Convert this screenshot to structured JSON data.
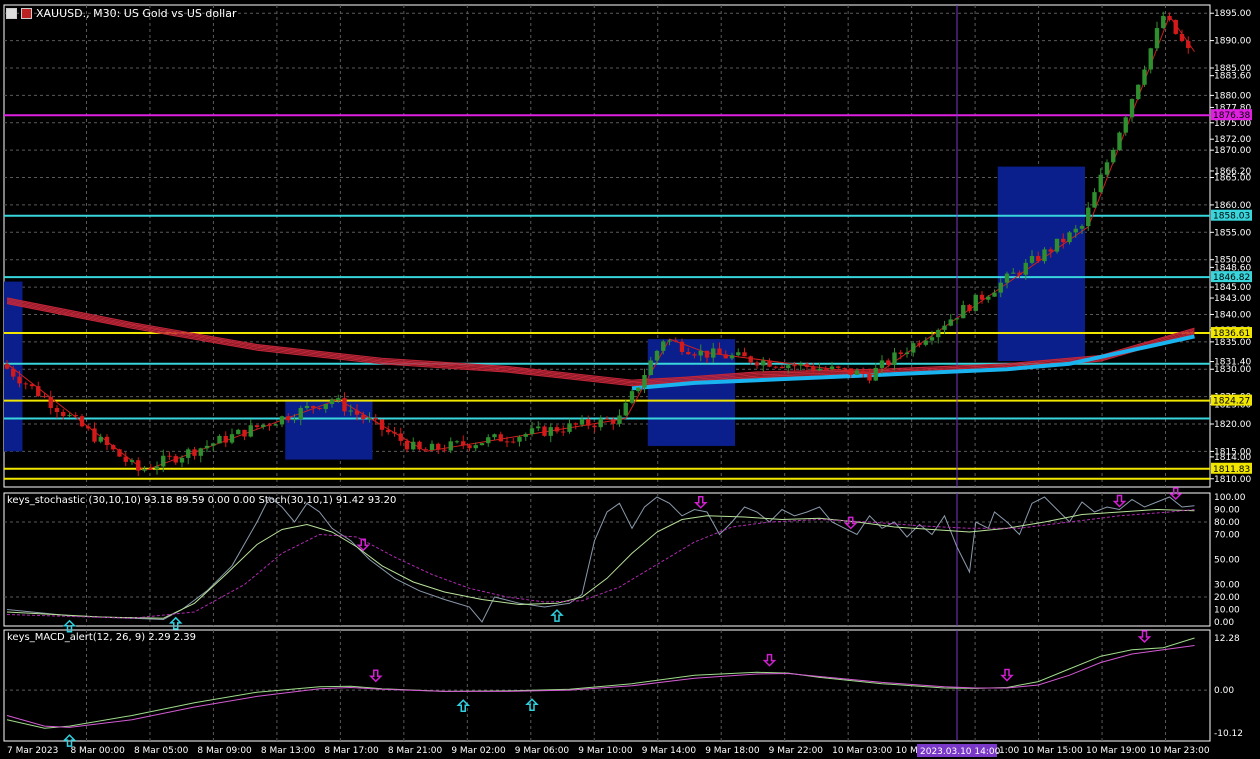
{
  "header": {
    "title": "XAUUSD., M30:  US Gold vs US dollar"
  },
  "colors": {
    "background": "#000000",
    "grid": "#5a5a5a",
    "bull": "#2f8f2f",
    "bear": "#d21a1a",
    "ma_red": "#c02638",
    "ma_blue": "#19b4f0",
    "level_yellow": "#f0e600",
    "level_cyan": "#38d6dc",
    "level_magenta": "#e020e0",
    "zone_blue": "#0a1e8c",
    "zigzag": "#d02020",
    "stoch_main": "#8a9aac",
    "stoch_signal": "#b8e29a",
    "stoch_dash": "#b02ab0",
    "macd_main": "#9fdc8a",
    "macd_signal": "#d45ad4",
    "arrow_up": "#30d0e0",
    "arrow_down": "#d020d0",
    "vline": "#7a38c8"
  },
  "chart_data": [
    {
      "type": "candlestick",
      "title": "XAUUSD., M30:  US Gold vs US dollar",
      "ylim": [
        1808.5,
        1896.5
      ],
      "price_ticks": [
        "1895.00",
        "1890.00",
        "1885.00",
        "1883.60",
        "1880.00",
        "1877.80",
        "1875.00",
        "1872.00",
        "1870.00",
        "1866.20",
        "1865.00",
        "1860.00",
        "1855.00",
        "1850.00",
        "1848.60",
        "1845.00",
        "1843.00",
        "1840.00",
        "1837.20",
        "1835.00",
        "1831.40",
        "1830.00",
        "1825.00",
        "1823.60",
        "1820.00",
        "1815.00",
        "1814.00",
        "1810.00"
      ],
      "x_labels": [
        "7 Mar 2023",
        "8 Mar 00:00",
        "8 Mar 05:00",
        "8 Mar 09:00",
        "8 Mar 13:00",
        "8 Mar 17:00",
        "8 Mar 21:00",
        "9 Mar 02:00",
        "9 Mar 06:00",
        "9 Mar 10:00",
        "9 Mar 14:00",
        "9 Mar 18:00",
        "9 Mar 22:00",
        "10 Mar 03:00",
        "10 Mar 07:00",
        "10 Mar 11:00",
        "10 Mar 15:00",
        "10 Mar 19:00",
        "10 Mar 23:00"
      ],
      "cursor_time_label": "2023.03.10 14:00",
      "level_labels": [
        {
          "value": 1876.38,
          "text": "1876.38",
          "kind": "magenta"
        },
        {
          "value": 1858.03,
          "text": "1858.03",
          "kind": "cyan"
        },
        {
          "value": 1846.82,
          "text": "1846.82",
          "kind": "cyan"
        },
        {
          "value": 1836.61,
          "text": "1836.61",
          "kind": "yellow"
        },
        {
          "value": 1831.0,
          "text": "",
          "kind": "cyan"
        },
        {
          "value": 1824.27,
          "text": "1824.27",
          "kind": "yellow"
        },
        {
          "value": 1821.0,
          "text": "",
          "kind": "cyan"
        },
        {
          "value": 1811.83,
          "text": "1811.83",
          "kind": "yellow"
        },
        {
          "value": 1810.0,
          "text": "",
          "kind": "yellow"
        }
      ],
      "zones": [
        {
          "from": 0,
          "to": 2,
          "high": 1846.0,
          "low": 1815.0
        },
        {
          "from": 45,
          "to": 58,
          "high": 1824.5,
          "low": 1813.5
        },
        {
          "from": 103,
          "to": 116,
          "high": 1835.5,
          "low": 1816.0
        },
        {
          "from": 159,
          "to": 172,
          "high": 1867.0,
          "low": 1831.5
        }
      ],
      "zigzag": [
        [
          0,
          1831
        ],
        [
          22,
          1811.5
        ],
        [
          53,
          1824.5
        ],
        [
          67,
          1815
        ],
        [
          99,
          1821
        ],
        [
          106,
          1835.5
        ],
        [
          112,
          1833
        ],
        [
          139,
          1829
        ],
        [
          173,
          1856
        ],
        [
          186,
          1894.5
        ],
        [
          190,
          1888
        ]
      ],
      "ma_red": [
        [
          0,
          1842.5
        ],
        [
          20,
          1838
        ],
        [
          40,
          1834
        ],
        [
          60,
          1831.5
        ],
        [
          80,
          1830
        ],
        [
          100,
          1827.5
        ],
        [
          108,
          1828
        ],
        [
          120,
          1829
        ],
        [
          140,
          1829.5
        ],
        [
          160,
          1830.5
        ],
        [
          175,
          1832
        ],
        [
          190,
          1837
        ]
      ],
      "ma_blue": [
        [
          100,
          1826.5
        ],
        [
          110,
          1827.5
        ],
        [
          120,
          1828
        ],
        [
          140,
          1829
        ],
        [
          160,
          1830
        ],
        [
          170,
          1831
        ],
        [
          180,
          1833.5
        ],
        [
          190,
          1836
        ]
      ]
    },
    {
      "type": "line",
      "name": "keys_stochastic",
      "label": "keys_stochastic (30,10,10) 93.18 89.59 0.00 0.00 Stoch(30,10,1) 91.42 93.20",
      "ylim": [
        0,
        100
      ],
      "y_ticks": [
        "100.00",
        "90.00",
        "80.00",
        "70.00",
        "50.00",
        "30.00",
        "20.00",
        "10.00",
        "0.00"
      ],
      "main": [
        [
          0,
          10
        ],
        [
          10,
          5
        ],
        [
          20,
          3
        ],
        [
          25,
          2
        ],
        [
          28,
          10
        ],
        [
          32,
          25
        ],
        [
          36,
          45
        ],
        [
          40,
          80
        ],
        [
          42,
          100
        ],
        [
          44,
          92
        ],
        [
          46,
          80
        ],
        [
          48,
          95
        ],
        [
          50,
          88
        ],
        [
          52,
          75
        ],
        [
          55,
          65
        ],
        [
          58,
          50
        ],
        [
          62,
          35
        ],
        [
          66,
          25
        ],
        [
          70,
          18
        ],
        [
          74,
          12
        ],
        [
          76,
          0
        ],
        [
          78,
          20
        ],
        [
          82,
          15
        ],
        [
          86,
          12
        ],
        [
          90,
          15
        ],
        [
          92,
          22
        ],
        [
          94,
          65
        ],
        [
          96,
          88
        ],
        [
          98,
          95
        ],
        [
          100,
          75
        ],
        [
          102,
          92
        ],
        [
          104,
          100
        ],
        [
          106,
          95
        ],
        [
          108,
          85
        ],
        [
          110,
          90
        ],
        [
          112,
          88
        ],
        [
          114,
          70
        ],
        [
          116,
          80
        ],
        [
          118,
          92
        ],
        [
          120,
          88
        ],
        [
          122,
          80
        ],
        [
          124,
          90
        ],
        [
          126,
          85
        ],
        [
          128,
          88
        ],
        [
          130,
          92
        ],
        [
          132,
          80
        ],
        [
          136,
          70
        ],
        [
          138,
          85
        ],
        [
          140,
          75
        ],
        [
          142,
          80
        ],
        [
          144,
          68
        ],
        [
          146,
          78
        ],
        [
          148,
          70
        ],
        [
          150,
          85
        ],
        [
          152,
          60
        ],
        [
          154,
          40
        ],
        [
          155,
          80
        ],
        [
          157,
          75
        ],
        [
          158,
          88
        ],
        [
          160,
          80
        ],
        [
          162,
          70
        ],
        [
          164,
          95
        ],
        [
          166,
          100
        ],
        [
          168,
          90
        ],
        [
          170,
          80
        ],
        [
          172,
          96
        ],
        [
          174,
          88
        ],
        [
          176,
          92
        ],
        [
          178,
          90
        ],
        [
          180,
          98
        ],
        [
          182,
          92
        ],
        [
          184,
          96
        ],
        [
          186,
          100
        ],
        [
          188,
          92
        ],
        [
          190,
          93
        ]
      ],
      "signal": [
        [
          0,
          8
        ],
        [
          15,
          4
        ],
        [
          25,
          3
        ],
        [
          30,
          15
        ],
        [
          35,
          38
        ],
        [
          40,
          62
        ],
        [
          44,
          74
        ],
        [
          48,
          78
        ],
        [
          52,
          72
        ],
        [
          56,
          60
        ],
        [
          60,
          45
        ],
        [
          65,
          32
        ],
        [
          70,
          24
        ],
        [
          76,
          18
        ],
        [
          82,
          14
        ],
        [
          88,
          15
        ],
        [
          92,
          20
        ],
        [
          96,
          35
        ],
        [
          100,
          55
        ],
        [
          104,
          72
        ],
        [
          108,
          82
        ],
        [
          112,
          85
        ],
        [
          118,
          84
        ],
        [
          124,
          82
        ],
        [
          130,
          83
        ],
        [
          136,
          80
        ],
        [
          142,
          76
        ],
        [
          148,
          74
        ],
        [
          154,
          72
        ],
        [
          160,
          75
        ],
        [
          166,
          80
        ],
        [
          172,
          86
        ],
        [
          178,
          88
        ],
        [
          184,
          90
        ],
        [
          190,
          89
        ]
      ],
      "dash": [
        [
          0,
          6
        ],
        [
          20,
          3
        ],
        [
          30,
          8
        ],
        [
          38,
          30
        ],
        [
          44,
          55
        ],
        [
          50,
          70
        ],
        [
          56,
          68
        ],
        [
          62,
          52
        ],
        [
          68,
          38
        ],
        [
          74,
          27
        ],
        [
          80,
          20
        ],
        [
          86,
          16
        ],
        [
          92,
          17
        ],
        [
          98,
          28
        ],
        [
          104,
          46
        ],
        [
          110,
          64
        ],
        [
          116,
          76
        ],
        [
          122,
          80
        ],
        [
          130,
          82
        ],
        [
          138,
          80
        ],
        [
          146,
          77
        ],
        [
          154,
          75
        ],
        [
          162,
          75
        ],
        [
          170,
          80
        ],
        [
          178,
          85
        ],
        [
          186,
          88
        ],
        [
          190,
          90
        ]
      ],
      "arrows_up": [
        10,
        27,
        88
      ],
      "arrows_down": [
        57,
        111,
        135,
        178,
        187
      ]
    },
    {
      "type": "line",
      "name": "keys_MACD_alert",
      "label": "keys_MACD_alert(12, 26, 9) 2.29 2.39",
      "ylim": [
        -10.12,
        12.28
      ],
      "y_ticks": [
        "12.28",
        "0.00",
        "-10.12"
      ],
      "main": [
        [
          0,
          -7
        ],
        [
          6,
          -9
        ],
        [
          10,
          -8.5
        ],
        [
          20,
          -6
        ],
        [
          30,
          -3
        ],
        [
          40,
          -0.5
        ],
        [
          50,
          0.8
        ],
        [
          55,
          0.9
        ],
        [
          60,
          0.3
        ],
        [
          70,
          -0.3
        ],
        [
          80,
          -0.2
        ],
        [
          90,
          0.2
        ],
        [
          100,
          1.5
        ],
        [
          110,
          3.5
        ],
        [
          120,
          4.2
        ],
        [
          125,
          4
        ],
        [
          130,
          3
        ],
        [
          140,
          1.5
        ],
        [
          150,
          0.5
        ],
        [
          155,
          0.4
        ],
        [
          160,
          0.6
        ],
        [
          165,
          2
        ],
        [
          170,
          5
        ],
        [
          175,
          8
        ],
        [
          180,
          9.5
        ],
        [
          185,
          10
        ],
        [
          190,
          12.28
        ]
      ],
      "signal": [
        [
          0,
          -6
        ],
        [
          6,
          -8.5
        ],
        [
          10,
          -8.8
        ],
        [
          20,
          -7
        ],
        [
          30,
          -4
        ],
        [
          40,
          -1.5
        ],
        [
          50,
          0.3
        ],
        [
          55,
          0.6
        ],
        [
          60,
          0.2
        ],
        [
          70,
          -0.3
        ],
        [
          80,
          -0.3
        ],
        [
          90,
          0
        ],
        [
          100,
          1
        ],
        [
          110,
          2.8
        ],
        [
          120,
          3.8
        ],
        [
          125,
          3.9
        ],
        [
          130,
          3.2
        ],
        [
          140,
          1.8
        ],
        [
          150,
          0.8
        ],
        [
          155,
          0.5
        ],
        [
          160,
          0.5
        ],
        [
          165,
          1.2
        ],
        [
          170,
          3.5
        ],
        [
          175,
          6.5
        ],
        [
          180,
          8.5
        ],
        [
          185,
          9.5
        ],
        [
          190,
          10.5
        ]
      ],
      "arrows_up": [
        10,
        73,
        84
      ],
      "arrows_down": [
        59,
        122,
        160,
        182
      ]
    }
  ]
}
